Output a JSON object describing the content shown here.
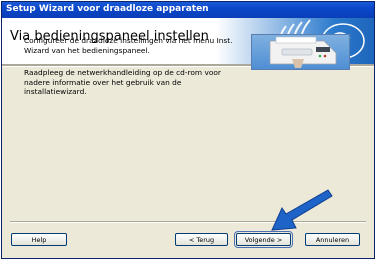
{
  "window": {
    "title": "Setup Wizard voor draadloze apparaten"
  },
  "header": {
    "title": "Via bedieningspaneel instellen"
  },
  "content": {
    "paragraph1": "Configureer de draadloze instellingen via het menu Inst. Wizard van het bedieningspaneel.",
    "paragraph2": "Raadpleeg de netwerkhandleiding op de cd-rom voor nadere informatie over het gebruik van de installatiewizard."
  },
  "buttons": {
    "help": "Help",
    "back": "< Terug",
    "next": "Volgende >",
    "cancel": "Annuleren"
  },
  "colors": {
    "titlebar": "#0b47c9",
    "brand_blue": "#1f66bb",
    "arrow": "#1e63c8",
    "dialog_bg": "#ece9d8"
  },
  "icons": {
    "brand": "wireless-signal-icon",
    "illustration": "printer-illustration",
    "pointer": "arrow-pointer-icon"
  }
}
